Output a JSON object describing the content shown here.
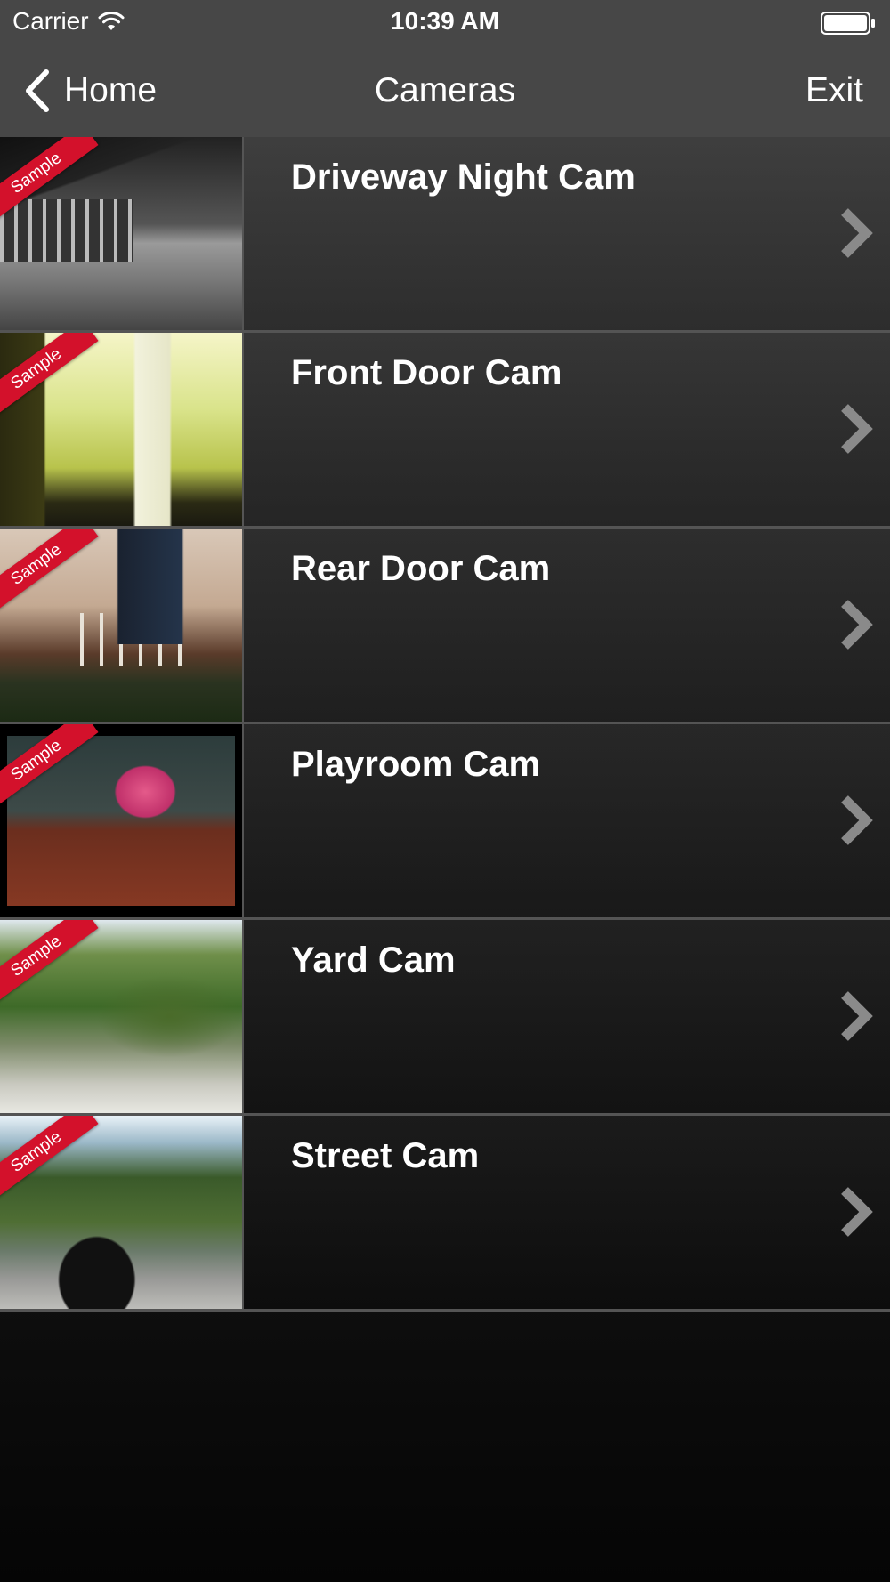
{
  "status_bar": {
    "carrier": "Carrier",
    "time": "10:39 AM",
    "wifi_icon": "wifi-icon",
    "battery_icon": "battery-icon"
  },
  "nav": {
    "back_label": "Home",
    "title": "Cameras",
    "exit_label": "Exit",
    "back_icon": "chevron-left-icon"
  },
  "cameras": [
    {
      "name": "Driveway Night Cam",
      "badge": "Sample"
    },
    {
      "name": "Front Door Cam",
      "badge": "Sample"
    },
    {
      "name": "Rear Door Cam",
      "badge": "Sample"
    },
    {
      "name": "Playroom Cam",
      "badge": "Sample"
    },
    {
      "name": "Yard Cam",
      "badge": "Sample"
    },
    {
      "name": "Street Cam",
      "badge": "Sample"
    }
  ],
  "colors": {
    "bar_background": "#474747",
    "badge_red": "#d3112b",
    "chevron_gray": "#8a8a8a",
    "row_divider": "#545454"
  }
}
